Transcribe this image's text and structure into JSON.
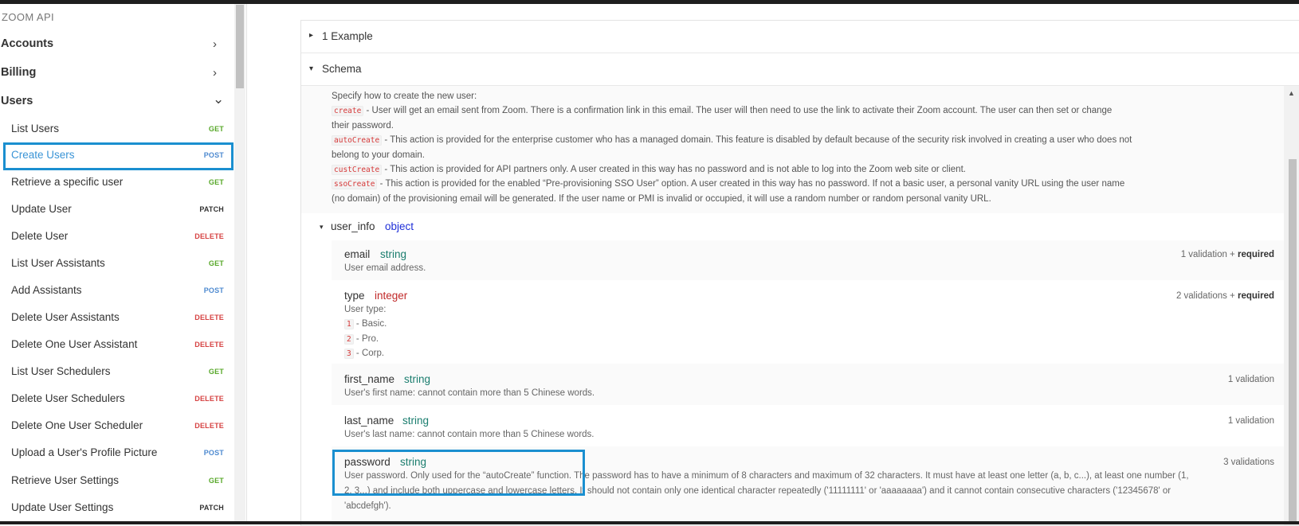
{
  "sidebar": {
    "title": "ZOOM API",
    "sections": [
      {
        "label": "Accounts",
        "chevron": "›"
      },
      {
        "label": "Billing",
        "chevron": "›"
      },
      {
        "label": "Users",
        "chevron": "⌄"
      }
    ],
    "items": [
      {
        "label": "List Users",
        "method": "GET"
      },
      {
        "label": "Create Users",
        "method": "POST",
        "active": true
      },
      {
        "label": "Retrieve a specific user",
        "method": "GET"
      },
      {
        "label": "Update User",
        "method": "PATCH"
      },
      {
        "label": "Delete User",
        "method": "DELETE"
      },
      {
        "label": "List User Assistants",
        "method": "GET"
      },
      {
        "label": "Add Assistants",
        "method": "POST"
      },
      {
        "label": "Delete User Assistants",
        "method": "DELETE"
      },
      {
        "label": "Delete One User Assistant",
        "method": "DELETE"
      },
      {
        "label": "List User Schedulers",
        "method": "GET"
      },
      {
        "label": "Delete User Schedulers",
        "method": "DELETE"
      },
      {
        "label": "Delete One User Scheduler",
        "method": "DELETE"
      },
      {
        "label": "Upload a User's Profile Picture",
        "method": "POST"
      },
      {
        "label": "Retrieve User Settings",
        "method": "GET"
      },
      {
        "label": "Update User Settings",
        "method": "PATCH"
      }
    ]
  },
  "main": {
    "example_label": "1 Example",
    "schema_label": "Schema",
    "action_intro": "Specify how to create the new user:",
    "actions": {
      "create_code": "create",
      "create_line1": " - User will get an email sent from Zoom. There is a confirmation link in this email. The user will then need to use the link to activate their Zoom account. The user can then set or change",
      "create_line2": "their password.",
      "auto_code": "autoCreate",
      "auto_line1": " - This action is provided for the enterprise customer who has a managed domain. This feature is disabled by default because of the security risk involved in creating a user who does not",
      "auto_line2": "belong to your domain.",
      "cust_code": "custCreate",
      "cust_line1": " - This action is provided for API partners only. A user created in this way has no password and is not able to log into the Zoom web site or client.",
      "sso_code": "ssoCreate",
      "sso_line1": " - This action is provided for the enabled “Pre-provisioning SSO User” option. A user created in this way has no password. If not a basic user, a personal vanity URL using the user name",
      "sso_line2": "(no domain) of the provisioning email will be generated. If the user name or PMI is invalid or occupied, it will use a random number or random personal vanity URL."
    },
    "user_info": {
      "name": "user_info",
      "type": "object"
    },
    "properties": {
      "email": {
        "name": "email",
        "type": "string",
        "validations": "1 validation + ",
        "required": "required",
        "desc": "User email address."
      },
      "type": {
        "name": "type",
        "type": "integer",
        "validations": "2 validations + ",
        "required": "required",
        "desc": "User type:",
        "opt1_code": "1",
        "opt1": " - Basic.",
        "opt2_code": "2",
        "opt2": " - Pro.",
        "opt3_code": "3",
        "opt3": " - Corp."
      },
      "first_name": {
        "name": "first_name",
        "type": "string",
        "validations": "1 validation",
        "desc": "User's first name: cannot contain more than 5 Chinese words."
      },
      "last_name": {
        "name": "last_name",
        "type": "string",
        "validations": "1 validation",
        "desc": "User's last name: cannot contain more than 5 Chinese words."
      },
      "password": {
        "name": "password",
        "type": "string",
        "validations": "3 validations",
        "desc1": "User password. Only used for the “autoCreate” function. The password has to have a minimum of 8 characters and maximum of 32 characters. It must have at least one letter (a, b, c...), at least one number (1,",
        "desc2": "2, 3...) and include both uppercase and lowercase letters. It should not contain only one identical character repeatedly ('11111111' or 'aaaaaaaa') and it cannot contain consecutive characters ('12345678' or",
        "desc3": "'abcdefgh')."
      }
    }
  },
  "icons": {
    "expand_open": "▾",
    "expand_closed": "▸",
    "scroll_up": "▲"
  }
}
